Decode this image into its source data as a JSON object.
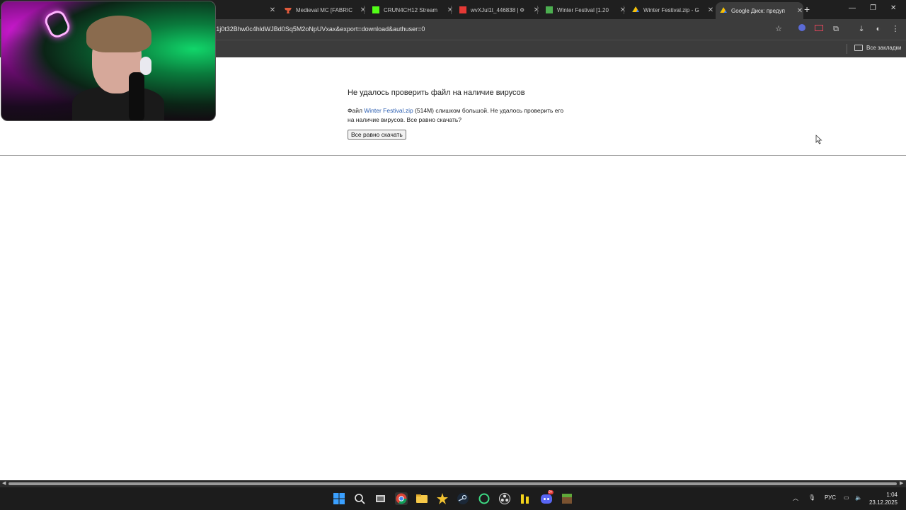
{
  "browser": {
    "tabs": [
      {
        "title": "Medieval MC [FABRIC",
        "favicon_color": "#e25b3c"
      },
      {
        "title": "CRUN4CH12 Stream",
        "favicon_color": "#53fc18"
      },
      {
        "title": "wvXJul1t_446838 | Ф",
        "favicon_color": "#e53935"
      },
      {
        "title": "Winter Festival [1.20",
        "favicon_color": "#4caf50"
      },
      {
        "title": "Winter Festival.zip - G",
        "favicon_color": "#34a853"
      },
      {
        "title": "Google Диск: предуп",
        "favicon_color": "#fbbc05"
      }
    ],
    "url": "=1j0t32Bhw0c4hldWJBd0Sq5M2oNpUVxax&export=download&authuser=0",
    "bookmarks_all": "Все закладки"
  },
  "page": {
    "title": "Не удалось проверить файл на наличие вирусов",
    "text_before": "Файл ",
    "file_link": "Winter Festival.zip",
    "text_after": " (514M) слишком большой. Не удалось проверить его на наличие вирусов. Все равно скачать?",
    "download_button": "Все равно скачать"
  },
  "taskbar": {
    "language": "РУС",
    "time": "1:04",
    "date": "23.12.2025",
    "discord_badge": "9+"
  },
  "colors": {
    "link": "#2a5db0",
    "chrome_dark": "#1f1f1f",
    "toolbar": "#3c3c3c"
  }
}
